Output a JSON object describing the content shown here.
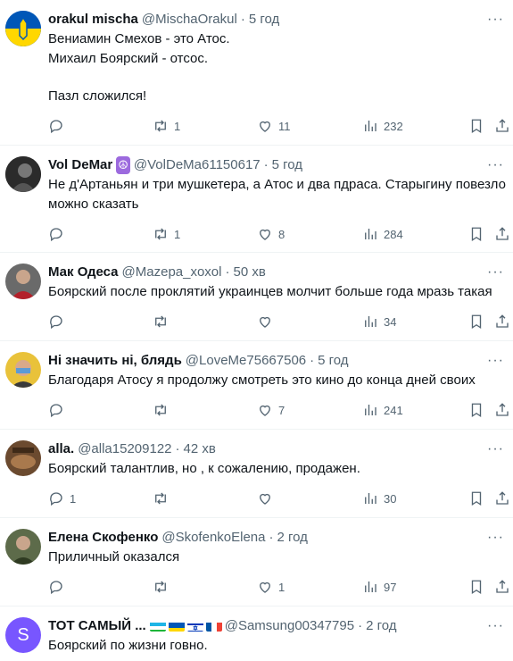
{
  "tweets": [
    {
      "name": "orakul mischa",
      "handle": "@MischaOrakul",
      "time": "5 год",
      "lines": [
        "Вениамин Смехов - это Атос.",
        "Михаил Боярский - отсос.",
        "",
        "Пазл сложился!"
      ],
      "retweets": "1",
      "likes": "11",
      "views": "232",
      "avatar": "ukraine-coat-of-arms"
    },
    {
      "name": "Vol DeMar",
      "name_emoji": "☮",
      "handle": "@VolDeMa61150617",
      "time": "5 год",
      "lines": [
        "Не д'Артаньян и три мушкетера, а Атос и два пдраса. Старыгину повезло",
        "можно сказать"
      ],
      "retweets": "1",
      "likes": "8",
      "views": "284",
      "avatar": "photo-dark"
    },
    {
      "name": "Мак Одеса",
      "handle": "@Mazepa_xoxol",
      "time": "50 хв",
      "lines": [
        "Боярский после проклятий украинцев молчит больше года мразь такая"
      ],
      "retweets": "",
      "likes": "",
      "views": "34",
      "avatar": "photo-red"
    },
    {
      "name": "Ні значить ні, блядь",
      "handle": "@LoveMe75667506",
      "time": "5 год",
      "lines": [
        "Благодаря Атосу я продолжу смотреть это кино до конца дней своих"
      ],
      "retweets": "",
      "likes": "7",
      "views": "241",
      "avatar": "photo-yellow"
    },
    {
      "name": "alla.",
      "handle": "@alla15209122",
      "time": "42 хв",
      "lines": [
        "Боярский талантлив, но , к сожалению, продажен."
      ],
      "replies": "1",
      "retweets": "",
      "likes": "",
      "views": "30",
      "avatar": "photo-brown"
    },
    {
      "name": "Елена Скофенко",
      "handle": "@SkofenkoElena",
      "time": "2 год",
      "lines": [
        "Приличный оказался"
      ],
      "retweets": "",
      "likes": "1",
      "views": "97",
      "avatar": "photo-green"
    },
    {
      "name": "ТОТ САМЫЙ ...",
      "handle": "@Samsung00347795",
      "time": "2 год",
      "lines": [
        "Боярский по жизни говно."
      ],
      "avatar_letter": "S",
      "avatar": "letter-purple"
    }
  ],
  "colors": {
    "text": "#0f1419",
    "muted": "#536471",
    "border": "#eff3f4",
    "avatar_purple": "#7856ff"
  },
  "icons": [
    "reply-icon",
    "retweet-icon",
    "like-icon",
    "views-icon",
    "bookmark-icon",
    "share-icon",
    "more-icon"
  ]
}
